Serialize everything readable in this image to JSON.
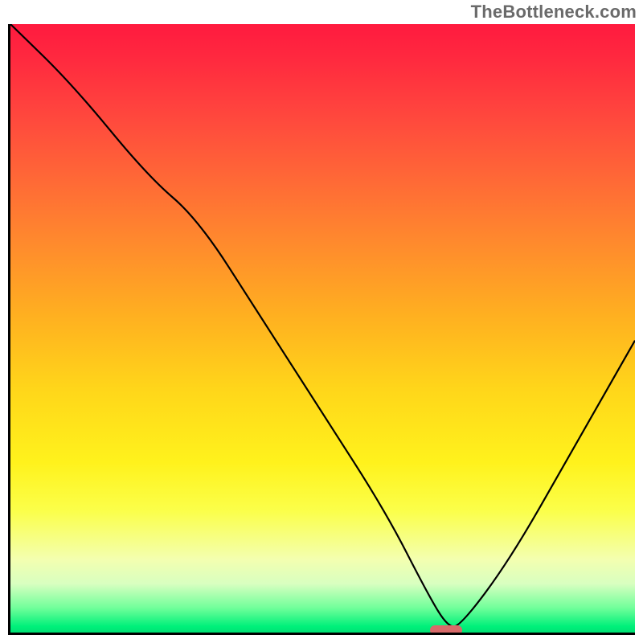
{
  "watermark": "TheBottleneck.com",
  "chart_data": {
    "type": "line",
    "title": "",
    "xlabel": "",
    "ylabel": "",
    "xlim": [
      0,
      100
    ],
    "ylim": [
      0,
      100
    ],
    "grid": false,
    "series": [
      {
        "name": "curve",
        "x": [
          0,
          10,
          22,
          30,
          40,
          50,
          60,
          67,
          70,
          72,
          80,
          90,
          100
        ],
        "y": [
          100,
          90,
          75,
          68,
          52,
          36,
          20,
          6,
          1,
          1,
          12,
          30,
          48
        ]
      }
    ],
    "background_gradient": {
      "stops": [
        {
          "pos": 0.0,
          "color": "#ff1a3f"
        },
        {
          "pos": 0.5,
          "color": "#ffb020"
        },
        {
          "pos": 0.8,
          "color": "#fbff4a"
        },
        {
          "pos": 0.96,
          "color": "#6fff9a"
        },
        {
          "pos": 1.0,
          "color": "#00e074"
        }
      ]
    },
    "valley_marker": {
      "x": 69.5,
      "y": 0.8,
      "width_pct": 5.1,
      "color": "#d86a6a"
    }
  }
}
